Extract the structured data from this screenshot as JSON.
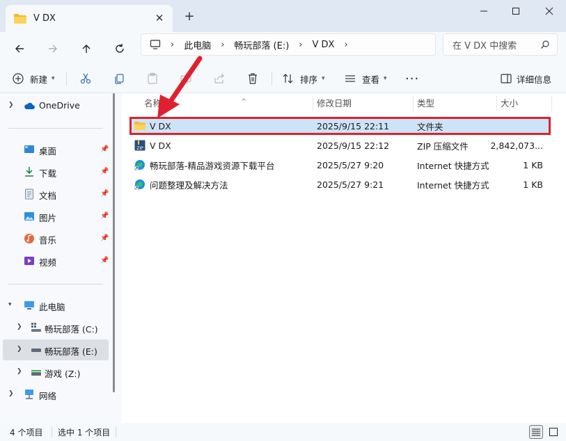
{
  "tab": {
    "title": "V DX"
  },
  "address": {
    "segments": [
      "此电脑",
      "畅玩部落 (E:)",
      "V DX"
    ]
  },
  "search": {
    "placeholder": "在 V DX 中搜索"
  },
  "toolbar": {
    "new_label": "新建",
    "sort_label": "排序",
    "view_label": "查看",
    "details_label": "详细信息"
  },
  "sidebar": {
    "onedrive": "OneDrive",
    "quick_access": [
      {
        "label": "桌面"
      },
      {
        "label": "下载"
      },
      {
        "label": "文档"
      },
      {
        "label": "图片"
      },
      {
        "label": "音乐"
      },
      {
        "label": "视频"
      }
    ],
    "this_pc": "此电脑",
    "drives": [
      {
        "label": "畅玩部落 (C:)"
      },
      {
        "label": "畅玩部落 (E:)"
      },
      {
        "label": "游戏 (Z:)"
      }
    ],
    "network": "网络"
  },
  "columns": {
    "name": "名称",
    "modified": "修改日期",
    "type": "类型",
    "size": "大小"
  },
  "files": [
    {
      "name": "V DX",
      "modified": "2025/9/15 22:11",
      "type": "文件夹",
      "size": ""
    },
    {
      "name": "V DX",
      "modified": "2025/9/15 22:12",
      "type": "ZIP 压缩文件",
      "size": "2,842,073..."
    },
    {
      "name": "畅玩部落-精品游戏资源下载平台",
      "modified": "2025/5/27 9:20",
      "type": "Internet 快捷方式",
      "size": "1 KB"
    },
    {
      "name": "问题整理及解决方法",
      "modified": "2025/5/27 9:21",
      "type": "Internet 快捷方式",
      "size": "1 KB"
    }
  ],
  "status": {
    "count": "4 个项目",
    "selected": "选中 1 个项目"
  },
  "colors": {
    "accent": "#0067c0",
    "selection": "#cce4f7",
    "highlight": "#e0202e",
    "arrow": "#e0202e"
  }
}
